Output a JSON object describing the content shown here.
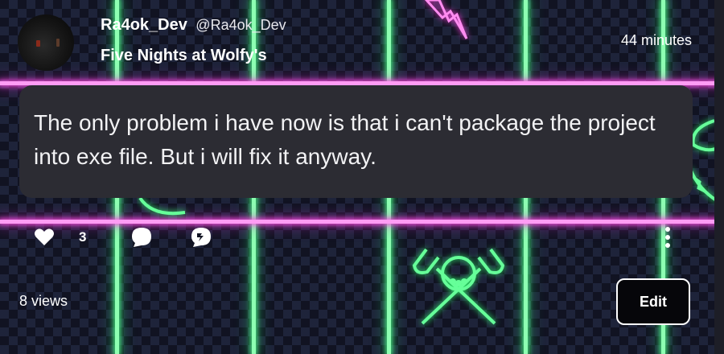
{
  "post": {
    "author_name": "Ra4ok_Dev",
    "author_handle": "@Ra4ok_Dev",
    "group_name": "Five Nights at Wolfy's",
    "timestamp": "44 minutes",
    "body": "The only problem i have now is that i can't package the project into exe file. But i will fix it anyway.",
    "like_count": "3",
    "views": "8 views",
    "edit_label": "Edit"
  },
  "icons": {
    "like": "heart-icon",
    "comment": "speech-bubble-icon",
    "share": "share-bubble-icon",
    "more": "vertical-dots-icon"
  },
  "colors": {
    "neon_green": "#8dffb2",
    "neon_pink": "#ff9cf4",
    "post_bubble": "#2c2c33",
    "text": "#ffffff"
  }
}
